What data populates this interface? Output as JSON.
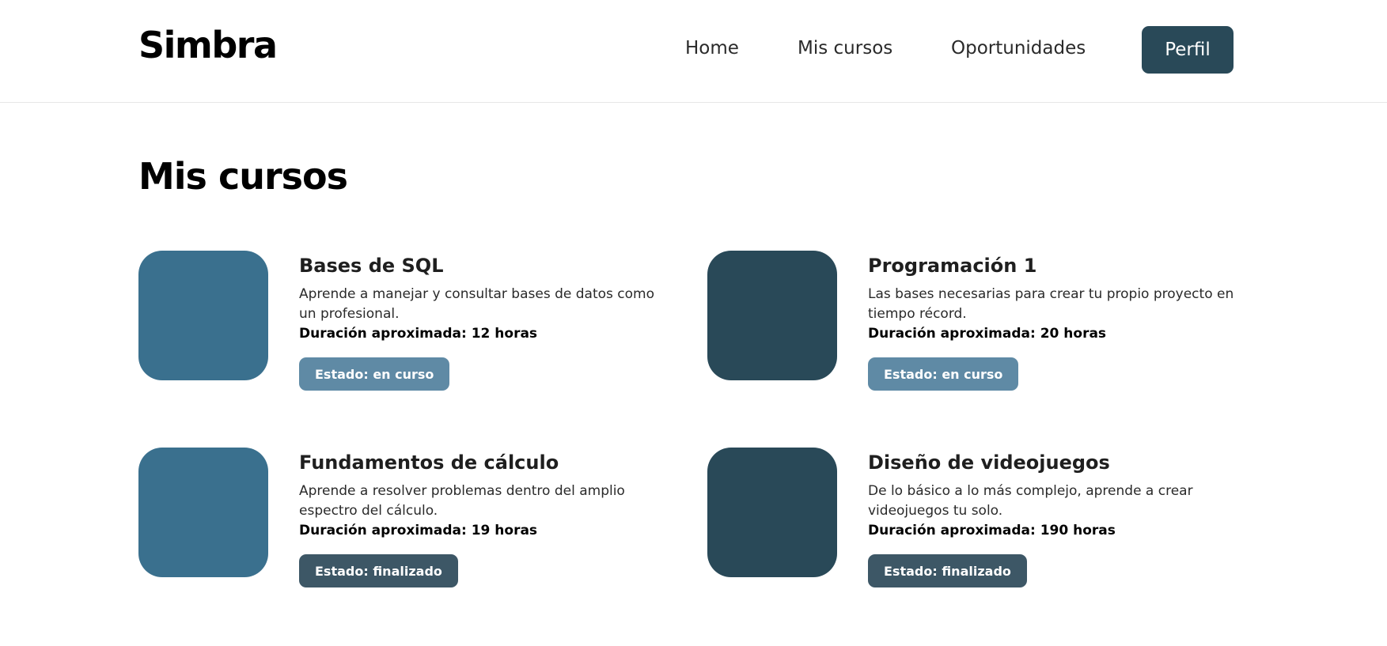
{
  "header": {
    "brand": "Simbra",
    "nav": [
      "Home",
      "Mis cursos",
      "Oportunidades"
    ],
    "profile_label": "Perfil"
  },
  "page": {
    "title": "Mis cursos"
  },
  "courses": [
    {
      "title": "Bases de SQL",
      "description": "Aprende a manejar y consultar bases de datos como un profesional.",
      "duration": "Duración aproximada: 12 horas",
      "status": "Estado: en curso",
      "thumb_color": "#3a708e"
    },
    {
      "title": "Programación 1",
      "description": "Las bases necesarias para crear tu propio proyecto en tiempo récord.",
      "duration": "Duración aproximada: 20 horas",
      "status": "Estado: en curso",
      "thumb_color": "#294958"
    },
    {
      "title": "Fundamentos de cálculo",
      "description": "Aprende a resolver problemas dentro del amplio espectro del cálculo.",
      "duration": "Duración aproximada: 19 horas",
      "status": "Estado: finalizado",
      "thumb_color": "#3a708e"
    },
    {
      "title": "Diseño de videojuegos",
      "description": "De lo básico a lo más complejo, aprende a crear videojuegos tu solo.",
      "duration": "Duración aproximada: 190 horas",
      "status": "Estado: finalizado",
      "thumb_color": "#294958"
    }
  ],
  "colors": {
    "primary_dark": "#294958",
    "primary": "#3a708e",
    "status_in_progress": "#5f8aa5",
    "status_finished": "#3d5766"
  }
}
